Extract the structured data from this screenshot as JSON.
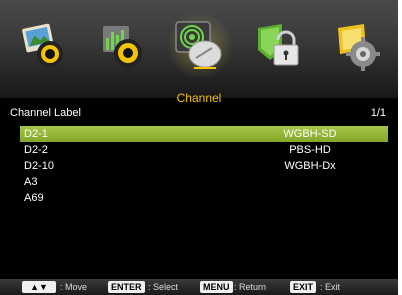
{
  "menu": {
    "tabs": [
      {
        "name": "picture",
        "icon": "picture-icon"
      },
      {
        "name": "sound",
        "icon": "sound-icon"
      },
      {
        "name": "channel",
        "icon": "satellite-dish-icon",
        "active": true
      },
      {
        "name": "lock",
        "icon": "lock-icon"
      },
      {
        "name": "setup",
        "icon": "gear-icon"
      }
    ],
    "active_title": "Channel"
  },
  "list_header": {
    "label": "Channel Label",
    "page": "1/1"
  },
  "channels": [
    {
      "number": "D2-1",
      "name": "WGBH-SD",
      "selected": true
    },
    {
      "number": "D2-2",
      "name": "PBS-HD",
      "selected": false
    },
    {
      "number": "D2-10",
      "name": "WGBH-Dx",
      "selected": false
    },
    {
      "number": "A3",
      "name": "",
      "selected": false
    },
    {
      "number": "A69",
      "name": "",
      "selected": false
    }
  ],
  "footer": {
    "move_key": "▲▼",
    "move_label": ": Move",
    "enter_key": "ENTER",
    "enter_label": ": Select",
    "menu_key": "MENU",
    "menu_label": ": Return",
    "exit_key": "EXIT",
    "exit_label": ": Exit"
  },
  "colors": {
    "title": "#f5c400",
    "selection": "#95b53a",
    "background": "#000000"
  }
}
